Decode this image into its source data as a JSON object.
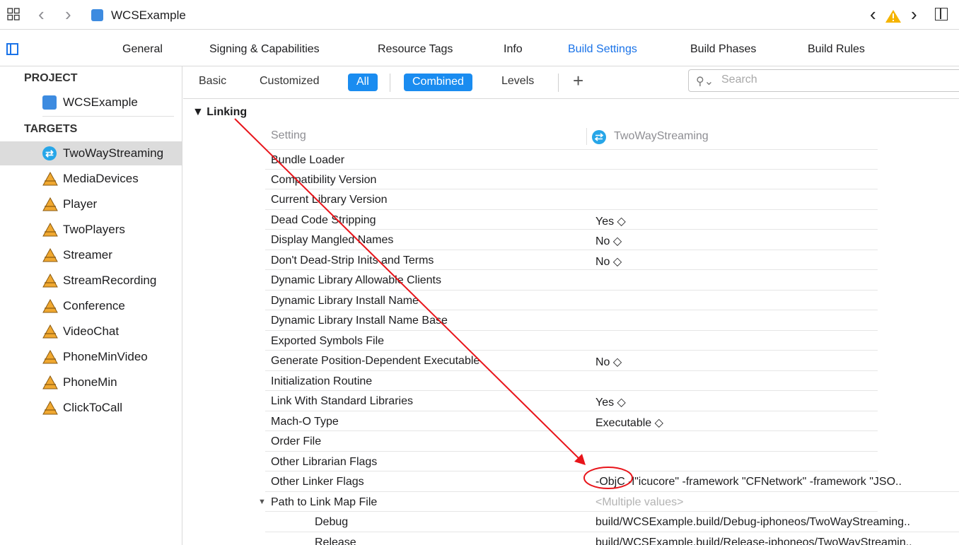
{
  "window": {
    "project_name": "WCSExample"
  },
  "tabs": [
    "General",
    "Signing & Capabilities",
    "Resource Tags",
    "Info",
    "Build Settings",
    "Build Phases",
    "Build Rules"
  ],
  "navigator": {
    "project_header": "PROJECT",
    "project_item": "WCSExample",
    "targets_header": "TARGETS",
    "targets": [
      "TwoWayStreaming",
      "MediaDevices",
      "Player",
      "TwoPlayers",
      "Streamer",
      "StreamRecording",
      "Conference",
      "VideoChat",
      "PhoneMinVideo",
      "PhoneMin",
      "ClickToCall"
    ],
    "selected_target": "TwoWayStreaming"
  },
  "filter": {
    "basic": "Basic",
    "customized": "Customized",
    "all": "All",
    "combined": "Combined",
    "levels": "Levels",
    "add": "+",
    "search_placeholder": "Search"
  },
  "settings": {
    "section": "Linking",
    "column_setting": "Setting",
    "column_target": "TwoWayStreaming",
    "rows": [
      {
        "name": "Bundle Loader",
        "value": ""
      },
      {
        "name": "Compatibility Version",
        "value": ""
      },
      {
        "name": "Current Library Version",
        "value": ""
      },
      {
        "name": "Dead Code Stripping",
        "value": "Yes ◇"
      },
      {
        "name": "Display Mangled Names",
        "value": "No ◇"
      },
      {
        "name": "Don't Dead-Strip Inits and Terms",
        "value": "No ◇"
      },
      {
        "name": "Dynamic Library Allowable Clients",
        "value": ""
      },
      {
        "name": "Dynamic Library Install Name",
        "value": ""
      },
      {
        "name": "Dynamic Library Install Name Base",
        "value": ""
      },
      {
        "name": "Exported Symbols File",
        "value": ""
      },
      {
        "name": "Generate Position-Dependent Executable",
        "value": "No ◇"
      },
      {
        "name": "Initialization Routine",
        "value": ""
      },
      {
        "name": "Link With Standard Libraries",
        "value": "Yes ◇"
      },
      {
        "name": "Mach-O Type",
        "value": "Executable ◇"
      },
      {
        "name": "Order File",
        "value": ""
      },
      {
        "name": "Other Librarian Flags",
        "value": ""
      },
      {
        "name": "Other Linker Flags",
        "value": "-ObjC -l\"icucore\" -framework \"CFNetwork\" -framework \"JSO.."
      },
      {
        "name": "Path to Link Map File",
        "value": "<Multiple values>"
      },
      {
        "name": "Debug",
        "value": "build/WCSExample.build/Debug-iphoneos/TwoWayStreaming.."
      },
      {
        "name": "Release",
        "value": "build/WCSExample.build/Release-iphoneos/TwoWayStreamin.."
      }
    ]
  },
  "colors": {
    "accent": "#1a73e8",
    "pill": "#1a8cf0",
    "annotation": "#e8141a"
  }
}
